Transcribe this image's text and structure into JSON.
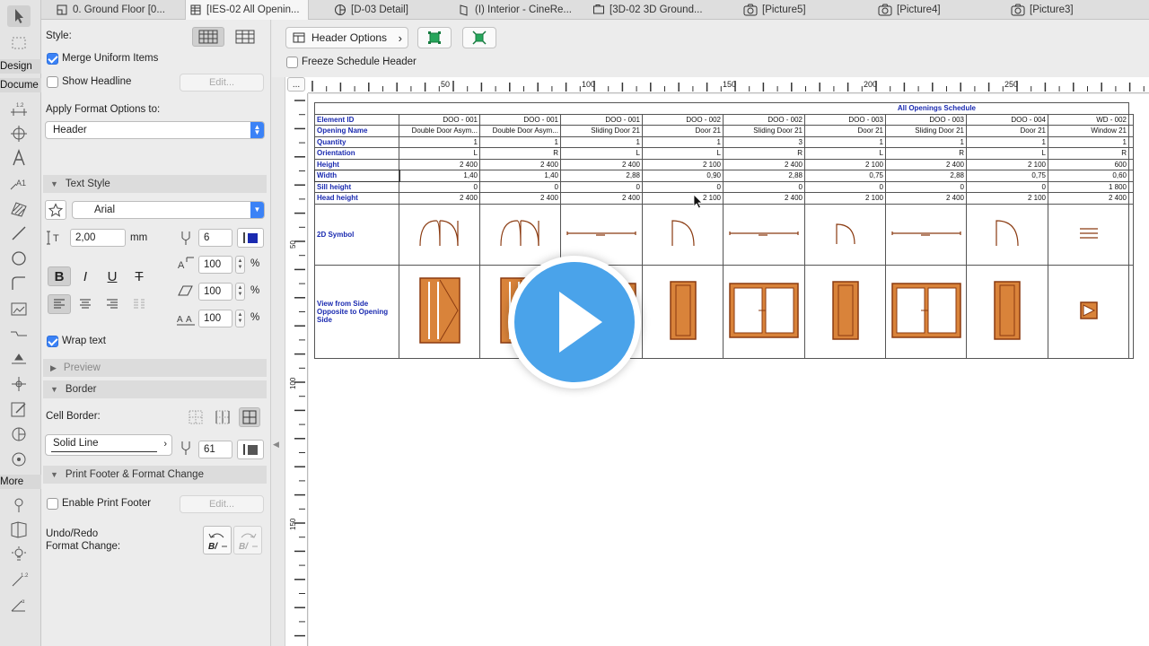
{
  "tabs": [
    {
      "label": "0. Ground Floor [0...",
      "icon": "floor-plan-icon"
    },
    {
      "label": "[IES-02 All Openin...",
      "icon": "schedule-icon",
      "active": true
    },
    {
      "label": "[D-03 Detail]",
      "icon": "detail-icon"
    },
    {
      "label": "(I) Interior - CineRe...",
      "icon": "interior-icon"
    },
    {
      "label": "[3D-02 3D Ground...",
      "icon": "3d-document-icon"
    },
    {
      "label": "[Picture5]",
      "icon": "camera-icon"
    },
    {
      "label": "[Picture4]",
      "icon": "camera-icon"
    },
    {
      "label": "[Picture3]",
      "icon": "camera-icon"
    }
  ],
  "toolbox": {
    "design_label": "Design",
    "document_label": "Docume",
    "more_label": "More"
  },
  "panel": {
    "style_label": "Style:",
    "merge_label": "Merge Uniform Items",
    "merge_checked": true,
    "headline_label": "Show Headline",
    "headline_checked": false,
    "edit_label": "Edit...",
    "apply_label": "Apply Format Options to:",
    "apply_value": "Header",
    "text_style_section": "Text Style",
    "font_value": "Arial",
    "size_value": "2,00",
    "size_unit": "mm",
    "pen_value": "6",
    "scale1": "100",
    "scale2": "100",
    "scale3": "100",
    "percent": "%",
    "bold": "B",
    "italic": "I",
    "underline": "U",
    "strike": "T",
    "wrap_label": "Wrap text",
    "wrap_checked": true,
    "preview_section": "Preview",
    "border_section": "Border",
    "cell_border_label": "Cell Border:",
    "line_value": "Solid Line",
    "line_pen": "61",
    "footer_section": "Print Footer & Format Change",
    "enable_footer_label": "Enable Print Footer",
    "enable_footer_checked": false,
    "footer_edit": "Edit...",
    "undo_label": "Undo/Redo\nFormat Change:"
  },
  "toolbar": {
    "header_options": "Header Options",
    "freeze_label": "Freeze Schedule Header",
    "freeze_checked": false,
    "dots": "..."
  },
  "ruler": {
    "h_labels": [
      "50",
      "100",
      "150",
      "200",
      "250"
    ],
    "v_labels": [
      "50",
      "100",
      "150"
    ]
  },
  "schedule": {
    "title": "All Openings Schedule",
    "rows": [
      {
        "label": "Element ID",
        "values": [
          "DOO - 001",
          "DOO - 001",
          "DOO - 001",
          "DOO - 002",
          "DOO - 002",
          "DOO - 003",
          "DOO - 003",
          "DOO - 004",
          "WD - 002"
        ]
      },
      {
        "label": "Opening Name",
        "values": [
          "Double Door Asym...",
          "Double Door Asym...",
          "Sliding Door 21",
          "Door 21",
          "Sliding Door 21",
          "Door 21",
          "Sliding Door 21",
          "Door 21",
          "Window 21"
        ]
      },
      {
        "label": "Quantity",
        "values": [
          "1",
          "1",
          "1",
          "1",
          "3",
          "1",
          "1",
          "1",
          "1"
        ]
      },
      {
        "label": "Orientation",
        "values": [
          "L",
          "R",
          "L",
          "L",
          "R",
          "L",
          "R",
          "L",
          "R"
        ]
      },
      {
        "label": "Height",
        "values": [
          "2 400",
          "2 400",
          "2 400",
          "2 100",
          "2 400",
          "2 100",
          "2 400",
          "2 100",
          "600"
        ]
      },
      {
        "label": "Width",
        "values": [
          "1,40",
          "1,40",
          "2,88",
          "0,90",
          "2,88",
          "0,75",
          "2,88",
          "0,75",
          "0,60"
        ]
      },
      {
        "label": "Sill height",
        "values": [
          "0",
          "0",
          "0",
          "0",
          "0",
          "0",
          "0",
          "0",
          "1 800"
        ]
      },
      {
        "label": "Head height",
        "values": [
          "2 400",
          "2 400",
          "2 400",
          "2 100",
          "2 400",
          "2 100",
          "2 400",
          "2 100",
          "2 400"
        ]
      }
    ],
    "symbol_label": "2D Symbol",
    "view_label": "View from Side Opposite to Opening Side"
  }
}
